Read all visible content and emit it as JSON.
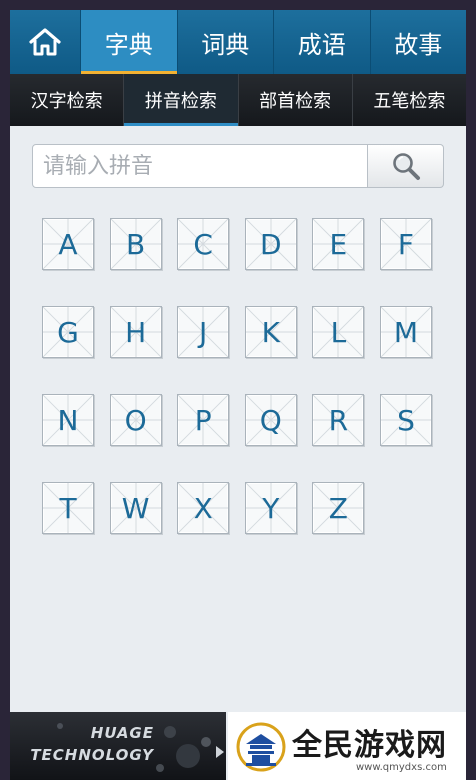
{
  "topnav": {
    "home_icon": "home-icon",
    "tabs": [
      {
        "label": "字典",
        "active": true
      },
      {
        "label": "词典",
        "active": false
      },
      {
        "label": "成语",
        "active": false
      },
      {
        "label": "故事",
        "active": false
      }
    ]
  },
  "subnav": {
    "tabs": [
      {
        "label": "汉字检索",
        "active": false
      },
      {
        "label": "拼音检索",
        "active": true
      },
      {
        "label": "部首检索",
        "active": false
      },
      {
        "label": "五笔检索",
        "active": false
      }
    ]
  },
  "search": {
    "placeholder": "请输入拼音",
    "value": "",
    "button_icon": "search-icon"
  },
  "letters": [
    "A",
    "B",
    "C",
    "D",
    "E",
    "F",
    "G",
    "H",
    "J",
    "K",
    "L",
    "M",
    "N",
    "O",
    "P",
    "Q",
    "R",
    "S",
    "T",
    "W",
    "X",
    "Y",
    "Z"
  ],
  "footer": {
    "brand_line1": "HUAGE",
    "brand_line2": "TECHNOLOGY"
  },
  "watermark": {
    "title": "全民游戏网",
    "url": "www.qmydxs.com"
  },
  "colors": {
    "topnav_bg": "#1d6f9d",
    "active_tab": "#2d8dc2",
    "accent_yellow": "#f2b233",
    "letter_text": "#1c6a98",
    "background": "#e9edf1"
  }
}
